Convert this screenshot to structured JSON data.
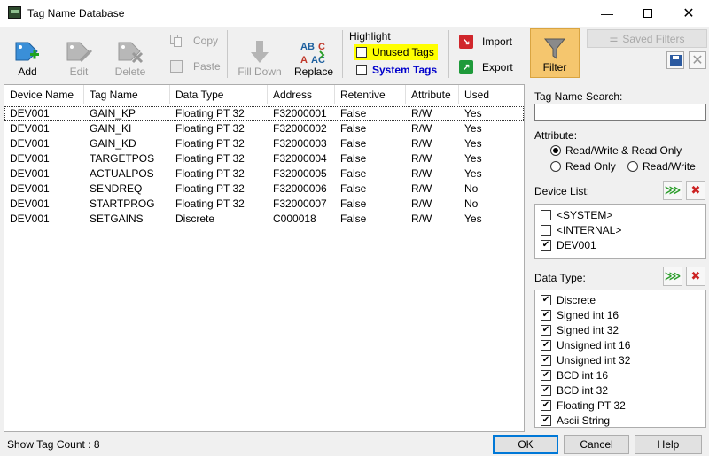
{
  "window": {
    "title": "Tag Name Database"
  },
  "toolbar": {
    "add": "Add",
    "edit": "Edit",
    "delete": "Delete",
    "copy": "Copy",
    "paste": "Paste",
    "fill_down": "Fill Down",
    "replace": "Replace",
    "highlight_title": "Highlight",
    "unused_tags": "Unused Tags",
    "system_tags": "System Tags",
    "import": "Import",
    "export": "Export",
    "filter": "Filter",
    "saved_filters": "Saved Filters"
  },
  "table": {
    "columns": [
      "Device Name",
      "Tag Name",
      "Data Type",
      "Address",
      "Retentive",
      "Attribute",
      "Used"
    ],
    "rows": [
      [
        "DEV001",
        "GAIN_KP",
        "Floating PT 32",
        "F32000001",
        "False",
        "R/W",
        "Yes"
      ],
      [
        "DEV001",
        "GAIN_KI",
        "Floating PT 32",
        "F32000002",
        "False",
        "R/W",
        "Yes"
      ],
      [
        "DEV001",
        "GAIN_KD",
        "Floating PT 32",
        "F32000003",
        "False",
        "R/W",
        "Yes"
      ],
      [
        "DEV001",
        "TARGETPOS",
        "Floating PT 32",
        "F32000004",
        "False",
        "R/W",
        "Yes"
      ],
      [
        "DEV001",
        "ACTUALPOS",
        "Floating PT 32",
        "F32000005",
        "False",
        "R/W",
        "Yes"
      ],
      [
        "DEV001",
        "SENDREQ",
        "Floating PT 32",
        "F32000006",
        "False",
        "R/W",
        "No"
      ],
      [
        "DEV001",
        "STARTPROG",
        "Floating PT 32",
        "F32000007",
        "False",
        "R/W",
        "No"
      ],
      [
        "DEV001",
        "SETGAINS",
        "Discrete",
        "C000018",
        "False",
        "R/W",
        "Yes"
      ]
    ]
  },
  "panel": {
    "search_label": "Tag Name Search:",
    "search_value": "",
    "attribute_label": "Attribute:",
    "attr_rw_read": "Read/Write & Read Only",
    "attr_read": "Read Only",
    "attr_rw": "Read/Write",
    "device_list_label": "Device List:",
    "devices": [
      "<SYSTEM>",
      "<INTERNAL>",
      "DEV001"
    ],
    "data_type_label": "Data Type:",
    "data_types": [
      "Discrete",
      "Signed int 16",
      "Signed int 32",
      "Unsigned int 16",
      "Unsigned int 32",
      "BCD int 16",
      "BCD int 32",
      "Floating PT 32",
      "Ascii String"
    ]
  },
  "footer": {
    "status": "Show Tag Count : 8",
    "ok": "OK",
    "cancel": "Cancel",
    "help": "Help"
  },
  "colors": {
    "highlight_yellow": "#ffff00",
    "system_tags_blue": "#0000cc",
    "filter_orange": "#f5c66e",
    "accent_blue": "#0078d7"
  }
}
